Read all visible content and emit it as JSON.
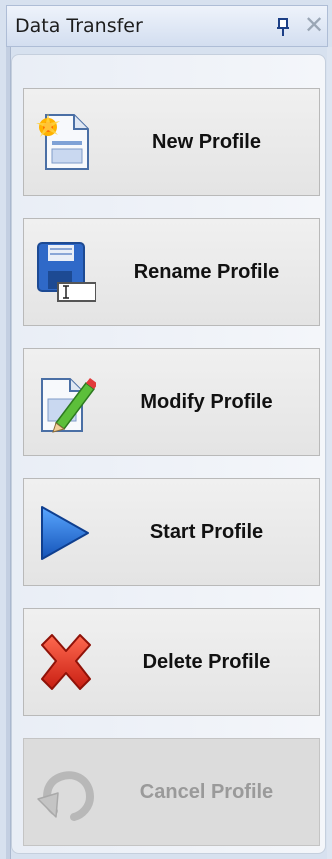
{
  "panel": {
    "title": "Data Transfer",
    "pin_icon": "pin-icon",
    "close_icon": "close-icon",
    "close_glyph": "✕"
  },
  "buttons": [
    {
      "label": "New Profile",
      "icon": "new-profile-icon",
      "enabled": true
    },
    {
      "label": "Rename Profile",
      "icon": "rename-profile-icon",
      "enabled": true
    },
    {
      "label": "Modify Profile",
      "icon": "modify-profile-icon",
      "enabled": true
    },
    {
      "label": "Start Profile",
      "icon": "play-icon",
      "enabled": true
    },
    {
      "label": "Delete Profile",
      "icon": "delete-x-icon",
      "enabled": true
    },
    {
      "label": "Cancel Profile",
      "icon": "undo-arrow-icon",
      "enabled": false
    }
  ],
  "colors": {
    "panel_bg": "#d7e1ef",
    "button_bg": "#e8e8e8",
    "play_blue": "#1f6fd6",
    "delete_red": "#e0301e",
    "disabled_text": "#9a9a9a"
  }
}
